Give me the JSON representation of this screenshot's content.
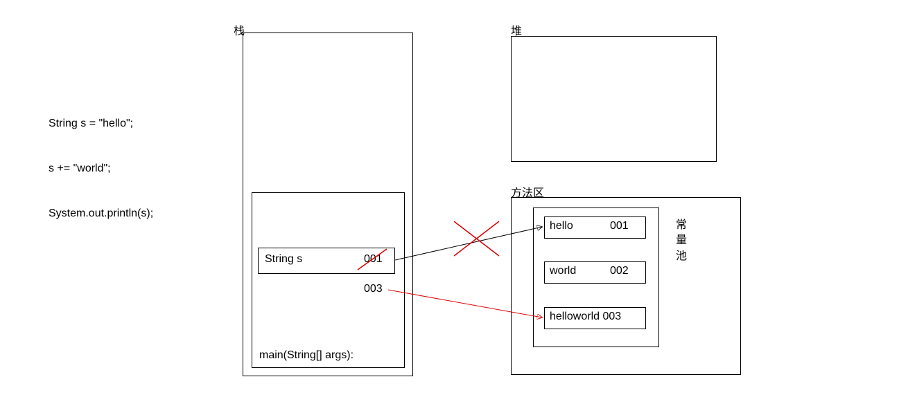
{
  "code": {
    "line1": "String s = \"hello\";",
    "line2": "s += \"world\";",
    "line3": "System.out.println(s);"
  },
  "labels": {
    "stack": "栈",
    "heap": "堆",
    "method_area": "方法区",
    "constant_pool": "常\n量\n池"
  },
  "stack_frame": {
    "var_label": "String s",
    "var_addr_old": "001",
    "var_addr_new": "003",
    "method_sig": "main(String[] args):"
  },
  "pool_entries": {
    "e1": {
      "text": "hello",
      "addr": "001"
    },
    "e2": {
      "text": "world",
      "addr": "002"
    },
    "e3": {
      "text": "helloworld 003"
    }
  }
}
